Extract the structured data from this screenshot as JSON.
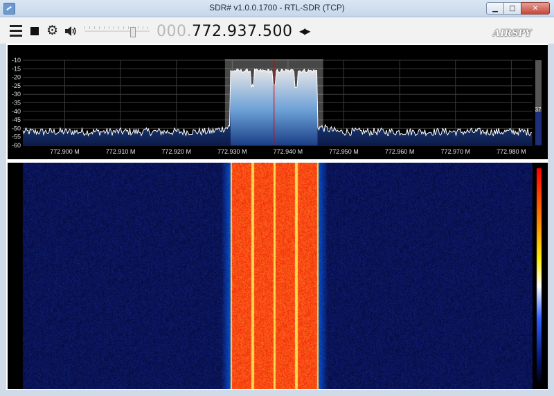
{
  "window": {
    "title": "SDR# v1.0.0.1700 - RTL-SDR (TCP)",
    "minimize_glyph": "▁",
    "maximize_glyph": "□",
    "close_glyph": "✕"
  },
  "toolbar": {
    "icons": [
      "menu-icon",
      "stop-icon",
      "gear-icon",
      "speaker-icon"
    ],
    "gear_glyph": "⚙",
    "volume_level": 0.75,
    "frequency_dim": "000.",
    "frequency_main": "772.937.500",
    "frequency_arrows": "◀▶",
    "brand": "AIRSPY"
  },
  "spectrum": {
    "y_ticks": [
      "-10",
      "-15",
      "-20",
      "-25",
      "-30",
      "-35",
      "-40",
      "-45",
      "-50",
      "-55",
      "-60"
    ],
    "x_ticks": [
      "772.900 M",
      "772.910 M",
      "772.920 M",
      "772.930 M",
      "772.940 M",
      "772.950 M",
      "772.960 M",
      "772.970 M",
      "772.980 M"
    ],
    "contrast_value": "37",
    "noise_floor_db": -52,
    "signal_level_db": -15,
    "band_start_mhz": 772.9297,
    "band_end_mhz": 772.9453,
    "tuned_mhz": 772.9375
  },
  "colors": {
    "plot_bg": "#000000",
    "grid": "#3a3a3a",
    "trace": "#ffffff",
    "fill_top": "#3f7fc4",
    "fill_bottom": "#0b1a4a",
    "tune_line": "#e00000",
    "waterfall_noise": "#07124a",
    "waterfall_signal": "#ff3a10"
  }
}
